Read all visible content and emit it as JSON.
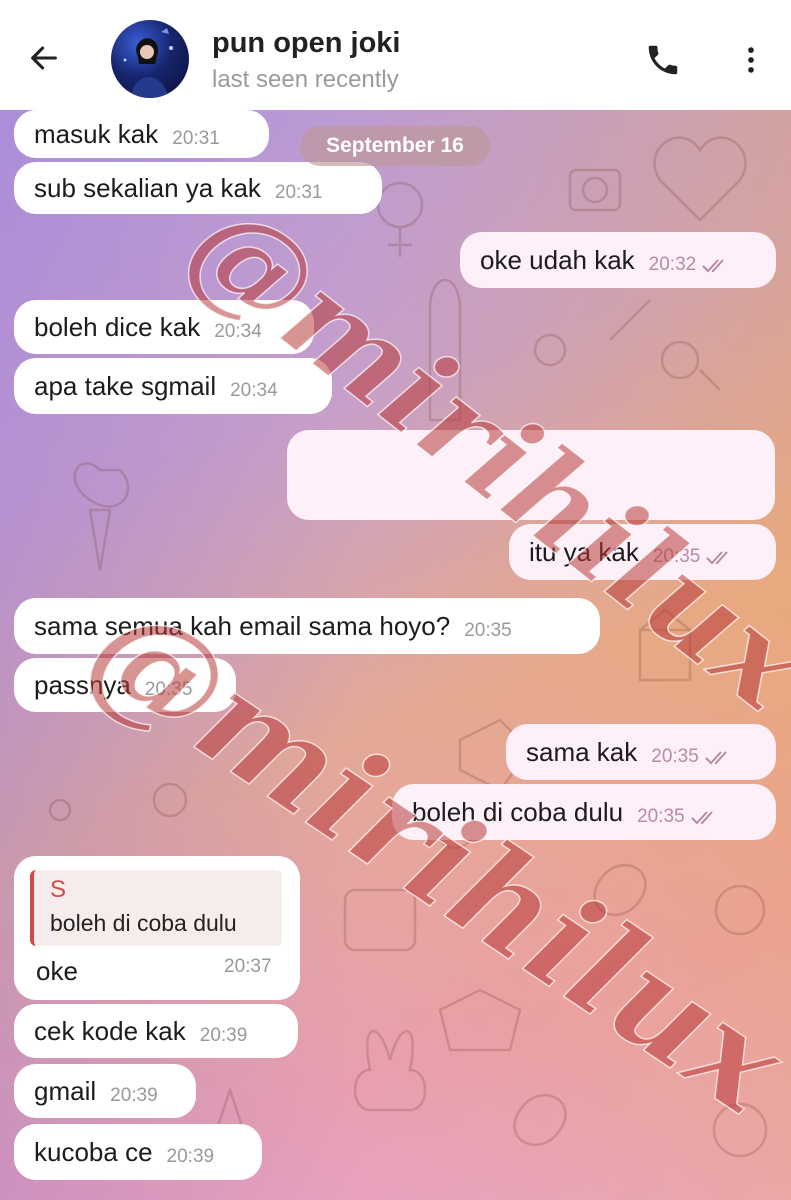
{
  "header": {
    "title": "pun open joki",
    "subtitle": "last seen recently"
  },
  "date_label": "September 16",
  "messages": [
    {
      "dir": "in",
      "text": "masuk kak",
      "time": "20:31"
    },
    {
      "dir": "in",
      "text": "sub sekalian ya kak",
      "time": "20:31"
    },
    {
      "dir": "out",
      "text": "oke udah kak",
      "time": "20:32",
      "read": true
    },
    {
      "dir": "in",
      "text": "boleh dice kak",
      "time": "20:34"
    },
    {
      "dir": "in",
      "text": "apa take sgmail",
      "time": "20:34"
    },
    {
      "dir": "out",
      "text": "",
      "time": "",
      "read": true
    },
    {
      "dir": "out",
      "text": "itu ya kak",
      "time": "20:35",
      "read": true
    },
    {
      "dir": "in",
      "text": "sama semua kah email sama hoyo?",
      "time": "20:35"
    },
    {
      "dir": "in",
      "text": "passnya",
      "time": "20:35"
    },
    {
      "dir": "out",
      "text": "sama kak",
      "time": "20:35",
      "read": true
    },
    {
      "dir": "out",
      "text": "boleh di coba dulu",
      "time": "20:35",
      "read": true
    },
    {
      "dir": "in",
      "text": "oke",
      "time": "20:37",
      "reply_to": {
        "sender": "S",
        "text": "boleh di coba dulu"
      }
    },
    {
      "dir": "in",
      "text": "cek kode kak",
      "time": "20:39"
    },
    {
      "dir": "in",
      "text": "gmail",
      "time": "20:39"
    },
    {
      "dir": "in",
      "text": "kucoba ce",
      "time": "20:39"
    }
  ],
  "watermark_text": "@mirihilux",
  "icons": {
    "back": "arrow-left-icon",
    "call": "phone-icon",
    "menu": "more-vertical-icon",
    "read": "double-check-icon"
  },
  "colors": {
    "incoming_bubble": "#ffffff",
    "outgoing_bubble": "#fdf0f9",
    "read_ticks": "#b98aa8",
    "reply_accent": "#d04b4b",
    "watermark": "#c0392b"
  }
}
